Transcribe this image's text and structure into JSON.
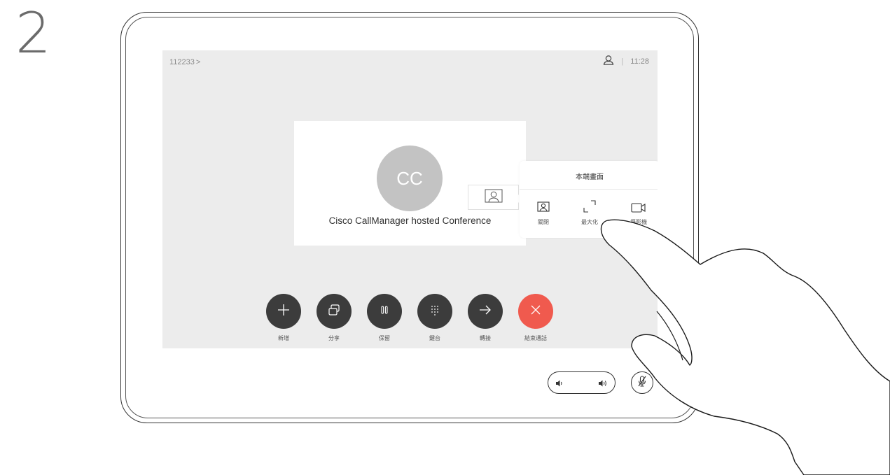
{
  "step_number": "2",
  "topbar": {
    "call_id": "112233",
    "chevron": ">",
    "person_icon": "person-icon",
    "separator": "|",
    "time": "11:28"
  },
  "call": {
    "avatar_initials": "CC",
    "name": "Cisco CallManager hosted Conference",
    "selfview_icon": "person-icon"
  },
  "selfview_menu": {
    "title": "本端畫面",
    "options": [
      {
        "label": "關閉",
        "icon": "person-frame-icon"
      },
      {
        "label": "最大化",
        "icon": "maximize-icon"
      },
      {
        "label": "攝影機",
        "icon": "camera-icon"
      }
    ]
  },
  "controls": [
    {
      "label": "新增",
      "icon": "plus-icon",
      "color": "#3c3c3c"
    },
    {
      "label": "分享",
      "icon": "share-icon",
      "color": "#3c3c3c"
    },
    {
      "label": "保留",
      "icon": "hold-icon",
      "color": "#3c3c3c"
    },
    {
      "label": "鍵台",
      "icon": "keypad-icon",
      "color": "#3c3c3c"
    },
    {
      "label": "轉接",
      "icon": "transfer-arrow-icon",
      "color": "#3c3c3c"
    },
    {
      "label": "結束通話",
      "icon": "close-icon",
      "color": "#f05a4e"
    }
  ],
  "hardware": {
    "volume_down_icon": "volume-down-icon",
    "volume_up_icon": "volume-up-icon",
    "mute_icon": "microphone-muted-icon"
  },
  "colors": {
    "screen_bg": "#ececec",
    "button_dark": "#3c3c3c",
    "end_call_red": "#f05a4e"
  }
}
